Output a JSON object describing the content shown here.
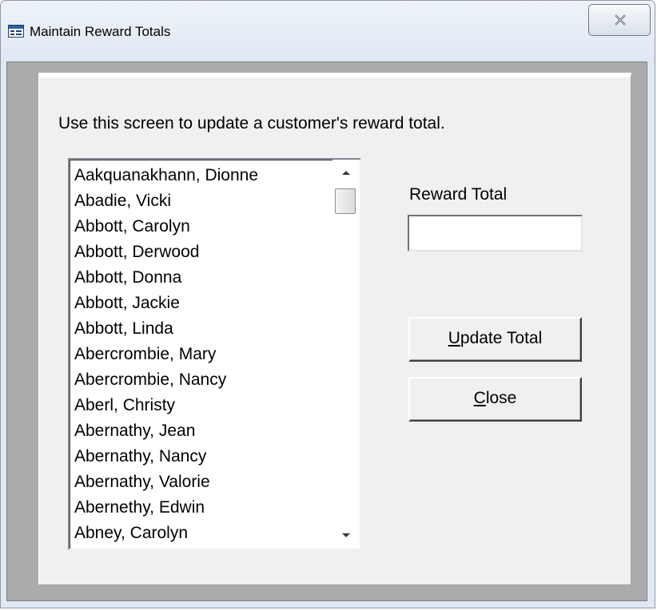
{
  "window": {
    "title": "Maintain Reward Totals",
    "icon": "form-window-icon",
    "close_icon": "close-x-icon"
  },
  "form": {
    "instruction": "Use this screen to update a customer's reward total.",
    "customer_list": {
      "items": [
        "Aakquanakhann, Dionne",
        "Abadie, Vicki",
        "Abbott, Carolyn",
        "Abbott, Derwood",
        "Abbott, Donna",
        "Abbott, Jackie",
        "Abbott, Linda",
        "Abercrombie, Mary",
        "Abercrombie, Nancy",
        "Aberl, Christy",
        "Abernathy, Jean",
        "Abernathy, Nancy",
        "Abernathy, Valorie",
        "Abernethy, Edwin",
        "Abney, Carolyn"
      ],
      "scroll_up_icon": "scroll-up-arrow-icon",
      "scroll_down_icon": "scroll-down-arrow-icon"
    },
    "reward_total": {
      "label": "Reward Total",
      "value": ""
    },
    "buttons": {
      "update_total": {
        "mnemonic": "U",
        "rest": "pdate Total"
      },
      "close": {
        "mnemonic": "C",
        "rest": "lose"
      }
    }
  },
  "colors": {
    "client_dark": "#ababab",
    "panel_bg": "#f0f0f0",
    "titlebar_bg": "#dfe8f3"
  }
}
